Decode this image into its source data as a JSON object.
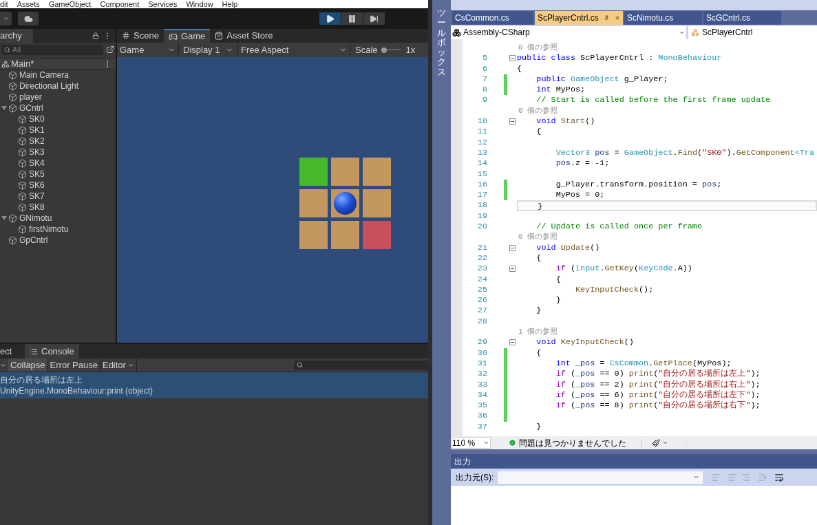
{
  "unity": {
    "menu": [
      "dit",
      "Assets",
      "GameObject",
      "Component",
      "Services",
      "Window",
      "Help"
    ],
    "play_controls": [
      {
        "kind": "play",
        "on": true
      },
      {
        "kind": "pause",
        "on": false
      },
      {
        "kind": "step",
        "on": false
      }
    ],
    "hierarchy": {
      "tab": "archy",
      "search": {
        "placeholder": "All"
      },
      "scene": "Main*",
      "items": [
        {
          "label": "Main Camera"
        },
        {
          "label": "Directional Light"
        },
        {
          "label": "player"
        },
        {
          "label": "GCntrl",
          "expanded": true,
          "children": [
            {
              "label": "SK0"
            },
            {
              "label": "SK1"
            },
            {
              "label": "SK2"
            },
            {
              "label": "SK3"
            },
            {
              "label": "SK4"
            },
            {
              "label": "SK5"
            },
            {
              "label": "SK6"
            },
            {
              "label": "SK7"
            },
            {
              "label": "SK8"
            }
          ]
        },
        {
          "label": "GNimotu",
          "expanded": true,
          "children": [
            {
              "label": "firstNimotu"
            }
          ]
        },
        {
          "label": "GpCntrl"
        }
      ]
    },
    "game_view": {
      "tabs": [
        {
          "label": "Scene",
          "kind": "scene",
          "selected": false
        },
        {
          "label": "Game",
          "kind": "game",
          "selected": true
        },
        {
          "label": "Asset Store",
          "kind": "store",
          "selected": false
        }
      ],
      "toolbar": {
        "mode": "Game",
        "display": "Display 1",
        "aspect": "Free Aspect",
        "scale_label": "Scale",
        "scale_value": "1x",
        "scale": {
          "level": 0
        }
      },
      "tiles": [
        {
          "color": "#45b82c",
          "has_ball": false
        },
        {
          "color": "#c4975f",
          "has_ball": false
        },
        {
          "color": "#c4975f",
          "has_ball": false
        },
        {
          "color": "#c4975f",
          "has_ball": false
        },
        {
          "color": "#c4975f",
          "has_ball": true
        },
        {
          "color": "#c4975f",
          "has_ball": false
        },
        {
          "color": "#c4975f",
          "has_ball": false
        },
        {
          "color": "#c4975f",
          "has_ball": false
        },
        {
          "color": "#c94f5c",
          "has_ball": false
        }
      ]
    },
    "console": {
      "tabs": [
        {
          "label": "ect",
          "selected": false
        },
        {
          "label": "Console",
          "selected": true
        }
      ],
      "buttons": [
        {
          "label": "Collapse",
          "on": true
        },
        {
          "label": "Error Pause",
          "on": false
        }
      ],
      "editor_menu": "Editor",
      "logs": [
        {
          "message": "自分の居る場所は左上",
          "trace": "UnityEngine.MonoBehaviour:print (object)",
          "selected": true
        }
      ]
    }
  },
  "vs": {
    "toolbox_label": "ツールボックス",
    "tabs": [
      {
        "label": "CsCommon.cs",
        "selected": false
      },
      {
        "label": "ScPlayerCntrl.cs",
        "selected": true
      },
      {
        "label": "ScNimotu.cs",
        "selected": false
      },
      {
        "label": "ScGCntrl.cs",
        "selected": false
      }
    ],
    "project_dropdown": "Assembly-CSharp",
    "class_dropdown": "ScPlayerCntrl",
    "code": [
      {
        "kind": "codelens",
        "text": "0 個の参照"
      },
      {
        "kind": "line",
        "number": "5",
        "changed": false,
        "foldable": true,
        "current": false,
        "tokens": [
          {
            "text": "public",
            "kind": "kw"
          },
          {
            "text": " class",
            "kind": "kw"
          },
          {
            "text": " ScPlayerCntrl : ",
            "kind": "plain"
          },
          {
            "text": "MonoBehaviour",
            "kind": "type"
          }
        ]
      },
      {
        "kind": "line",
        "number": "6",
        "changed": false,
        "foldable": false,
        "current": false,
        "tokens": [
          {
            "text": "{",
            "kind": "plain"
          }
        ]
      },
      {
        "kind": "line",
        "number": "7",
        "changed": true,
        "foldable": false,
        "current": false,
        "tokens": [
          {
            "text": "    public",
            "kind": "kw"
          },
          {
            "text": " GameObject",
            "kind": "type"
          },
          {
            "text": " g_Player;",
            "kind": "plain"
          }
        ]
      },
      {
        "kind": "line",
        "number": "8",
        "changed": true,
        "foldable": false,
        "current": false,
        "tokens": [
          {
            "text": "    int",
            "kind": "kw"
          },
          {
            "text": " MyPos;",
            "kind": "plain"
          }
        ]
      },
      {
        "kind": "line",
        "number": "9",
        "changed": false,
        "foldable": false,
        "current": false,
        "tokens": [
          {
            "text": "    // Start is called before the first frame update",
            "kind": "comment"
          }
        ]
      },
      {
        "kind": "codelens",
        "text": "0 個の参照"
      },
      {
        "kind": "line",
        "number": "10",
        "changed": false,
        "foldable": true,
        "current": false,
        "tokens": [
          {
            "text": "    void",
            "kind": "kw"
          },
          {
            "text": " Start",
            "kind": "method"
          },
          {
            "text": "()",
            "kind": "plain"
          }
        ]
      },
      {
        "kind": "line",
        "number": "11",
        "changed": false,
        "foldable": false,
        "current": false,
        "tokens": [
          {
            "text": "    {",
            "kind": "plain"
          }
        ]
      },
      {
        "kind": "line",
        "number": "12",
        "changed": false,
        "foldable": false,
        "current": false
      },
      {
        "kind": "line",
        "number": "13",
        "changed": false,
        "foldable": false,
        "current": false,
        "tokens": [
          {
            "text": "        Vector3",
            "kind": "type"
          },
          {
            "text": " pos",
            "kind": "local"
          },
          {
            "text": " = ",
            "kind": "plain"
          },
          {
            "text": "GameObject",
            "kind": "type"
          },
          {
            "text": ".",
            "kind": "plain"
          },
          {
            "text": "Find",
            "kind": "method"
          },
          {
            "text": "(",
            "kind": "plain"
          },
          {
            "text": "\"SK0\"",
            "kind": "str"
          },
          {
            "text": ").",
            "kind": "plain"
          },
          {
            "text": "GetComponent",
            "kind": "method"
          },
          {
            "text": "<Tra",
            "kind": "type"
          }
        ]
      },
      {
        "kind": "line",
        "number": "14",
        "changed": false,
        "foldable": false,
        "current": false,
        "tokens": [
          {
            "text": "        pos",
            "kind": "local"
          },
          {
            "text": ".z = -1;",
            "kind": "plain"
          }
        ]
      },
      {
        "kind": "line",
        "number": "15",
        "changed": false,
        "foldable": false,
        "current": false
      },
      {
        "kind": "line",
        "number": "16",
        "changed": true,
        "foldable": false,
        "current": false,
        "tokens": [
          {
            "text": "        g_Player.transform.position = ",
            "kind": "plain"
          },
          {
            "text": "pos",
            "kind": "local"
          },
          {
            "text": ";",
            "kind": "plain"
          }
        ]
      },
      {
        "kind": "line",
        "number": "17",
        "changed": true,
        "foldable": false,
        "current": false,
        "tokens": [
          {
            "text": "        MyPos = 0;",
            "kind": "plain"
          }
        ]
      },
      {
        "kind": "line",
        "number": "18",
        "changed": false,
        "foldable": false,
        "current": true,
        "tokens": [
          {
            "text": "    }",
            "kind": "plain"
          }
        ]
      },
      {
        "kind": "line",
        "number": "19",
        "changed": false,
        "foldable": false,
        "current": false
      },
      {
        "kind": "line",
        "number": "20",
        "changed": false,
        "foldable": false,
        "current": false,
        "tokens": [
          {
            "text": "    // Update is called once per frame",
            "kind": "comment"
          }
        ]
      },
      {
        "kind": "codelens",
        "text": "0 個の参照"
      },
      {
        "kind": "line",
        "number": "21",
        "changed": false,
        "foldable": true,
        "current": false,
        "tokens": [
          {
            "text": "    void",
            "kind": "kw"
          },
          {
            "text": " Update",
            "kind": "method"
          },
          {
            "text": "()",
            "kind": "plain"
          }
        ]
      },
      {
        "kind": "line",
        "number": "22",
        "changed": false,
        "foldable": false,
        "current": false,
        "tokens": [
          {
            "text": "    {",
            "kind": "plain"
          }
        ]
      },
      {
        "kind": "line",
        "number": "23",
        "changed": false,
        "foldable": true,
        "current": false,
        "tokens": [
          {
            "text": "        if",
            "kind": "ctrl"
          },
          {
            "text": " (",
            "kind": "plain"
          },
          {
            "text": "Input",
            "kind": "type"
          },
          {
            "text": ".",
            "kind": "plain"
          },
          {
            "text": "GetKey",
            "kind": "method"
          },
          {
            "text": "(",
            "kind": "plain"
          },
          {
            "text": "KeyCode",
            "kind": "type"
          },
          {
            "text": ".A))",
            "kind": "plain"
          }
        ]
      },
      {
        "kind": "line",
        "number": "24",
        "changed": false,
        "foldable": false,
        "current": false,
        "tokens": [
          {
            "text": "        {",
            "kind": "plain"
          }
        ]
      },
      {
        "kind": "line",
        "number": "25",
        "changed": false,
        "foldable": false,
        "current": false,
        "tokens": [
          {
            "text": "            KeyInputCheck",
            "kind": "method"
          },
          {
            "text": "();",
            "kind": "plain"
          }
        ]
      },
      {
        "kind": "line",
        "number": "26",
        "changed": false,
        "foldable": false,
        "current": false,
        "tokens": [
          {
            "text": "        }",
            "kind": "plain"
          }
        ]
      },
      {
        "kind": "line",
        "number": "27",
        "changed": false,
        "foldable": false,
        "current": false,
        "tokens": [
          {
            "text": "    }",
            "kind": "plain"
          }
        ]
      },
      {
        "kind": "line",
        "number": "28",
        "changed": false,
        "foldable": false,
        "current": false
      },
      {
        "kind": "codelens",
        "text": "1 個の参照"
      },
      {
        "kind": "line",
        "number": "29",
        "changed": false,
        "foldable": true,
        "current": false,
        "tokens": [
          {
            "text": "    void",
            "kind": "kw"
          },
          {
            "text": " KeyInputCheck",
            "kind": "method"
          },
          {
            "text": "()",
            "kind": "plain"
          }
        ]
      },
      {
        "kind": "line",
        "number": "30",
        "changed": true,
        "foldable": false,
        "current": false,
        "tokens": [
          {
            "text": "    {",
            "kind": "plain"
          }
        ]
      },
      {
        "kind": "line",
        "number": "31",
        "changed": true,
        "foldable": false,
        "current": false,
        "tokens": [
          {
            "text": "        int",
            "kind": "kw"
          },
          {
            "text": " _pos",
            "kind": "local"
          },
          {
            "text": " = ",
            "kind": "plain"
          },
          {
            "text": "CsCommon",
            "kind": "type"
          },
          {
            "text": ".",
            "kind": "plain"
          },
          {
            "text": "GetPlace",
            "kind": "method"
          },
          {
            "text": "(MyPos);",
            "kind": "plain"
          }
        ]
      },
      {
        "kind": "line",
        "number": "32",
        "changed": true,
        "foldable": false,
        "current": false,
        "tokens": [
          {
            "text": "        if",
            "kind": "ctrl"
          },
          {
            "text": " (",
            "kind": "plain"
          },
          {
            "text": "_pos",
            "kind": "local"
          },
          {
            "text": " == 0) ",
            "kind": "plain"
          },
          {
            "text": "print",
            "kind": "method"
          },
          {
            "text": "(",
            "kind": "plain"
          },
          {
            "text": "\"自分の居る場所は左上\"",
            "kind": "str"
          },
          {
            "text": ");",
            "kind": "plain"
          }
        ]
      },
      {
        "kind": "line",
        "number": "33",
        "changed": true,
        "foldable": false,
        "current": false,
        "tokens": [
          {
            "text": "        if",
            "kind": "ctrl"
          },
          {
            "text": " (",
            "kind": "plain"
          },
          {
            "text": "_pos",
            "kind": "local"
          },
          {
            "text": " == 2) ",
            "kind": "plain"
          },
          {
            "text": "print",
            "kind": "method"
          },
          {
            "text": "(",
            "kind": "plain"
          },
          {
            "text": "\"自分の居る場所は右上\"",
            "kind": "str"
          },
          {
            "text": ");",
            "kind": "plain"
          }
        ]
      },
      {
        "kind": "line",
        "number": "34",
        "changed": true,
        "foldable": false,
        "current": false,
        "tokens": [
          {
            "text": "        if",
            "kind": "ctrl"
          },
          {
            "text": " (",
            "kind": "plain"
          },
          {
            "text": "_pos",
            "kind": "local"
          },
          {
            "text": " == 6) ",
            "kind": "plain"
          },
          {
            "text": "print",
            "kind": "method"
          },
          {
            "text": "(",
            "kind": "plain"
          },
          {
            "text": "\"自分の居る場所は左下\"",
            "kind": "str"
          },
          {
            "text": ");",
            "kind": "plain"
          }
        ]
      },
      {
        "kind": "line",
        "number": "35",
        "changed": true,
        "foldable": false,
        "current": false,
        "tokens": [
          {
            "text": "        if",
            "kind": "ctrl"
          },
          {
            "text": " (",
            "kind": "plain"
          },
          {
            "text": "_pos",
            "kind": "local"
          },
          {
            "text": " == 8) ",
            "kind": "plain"
          },
          {
            "text": "print",
            "kind": "method"
          },
          {
            "text": "(",
            "kind": "plain"
          },
          {
            "text": "\"自分の居る場所は右下\"",
            "kind": "str"
          },
          {
            "text": ");",
            "kind": "plain"
          }
        ]
      },
      {
        "kind": "line",
        "number": "36",
        "changed": true,
        "foldable": false,
        "current": false
      },
      {
        "kind": "line",
        "number": "37",
        "changed": false,
        "foldable": false,
        "current": false,
        "tokens": [
          {
            "text": "    }",
            "kind": "plain"
          }
        ]
      }
    ],
    "status": {
      "zoom": "110 %",
      "message": "問題は見つかりませんでした"
    },
    "output": {
      "title": "出力",
      "source_label": "出力元(S):"
    }
  }
}
